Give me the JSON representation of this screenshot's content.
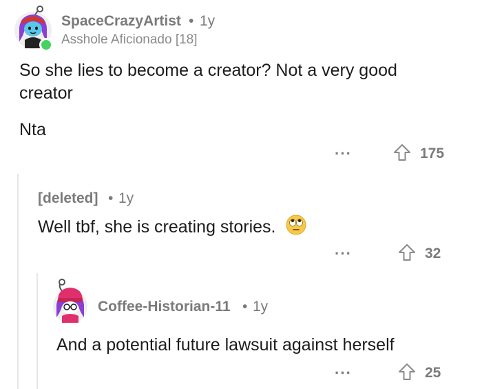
{
  "comments": [
    {
      "username": "SpaceCrazyArtist",
      "separator": "•",
      "age": "1y",
      "flair": "Asshole Aficionado [18]",
      "body_line1": "So she lies to become a creator? Not a very good",
      "body_line2": "creator",
      "body_line3": "Nta",
      "more": "···",
      "votes": "175"
    },
    {
      "username": "[deleted]",
      "separator": "•",
      "age": "1y",
      "body": "Well tbf, she is creating stories.",
      "emoji": "🙄",
      "more": "···",
      "votes": "32"
    },
    {
      "username": "Coffee-Historian-11",
      "separator": "•",
      "age": "1y",
      "body": "And a potential future lawsuit against herself",
      "more": "···",
      "votes": "25"
    }
  ],
  "colors": {
    "meta_gray": "#7a7a7a",
    "online_green": "#46d160",
    "thread_line": "#e6e6e6",
    "avatar1_hair": "#8a3fd6",
    "avatar1_skin": "#59c7e8",
    "avatar2_hat": "#e0306b"
  },
  "icons": {
    "more": "ellipsis-icon",
    "upvote": "upvote-arrow-icon"
  }
}
